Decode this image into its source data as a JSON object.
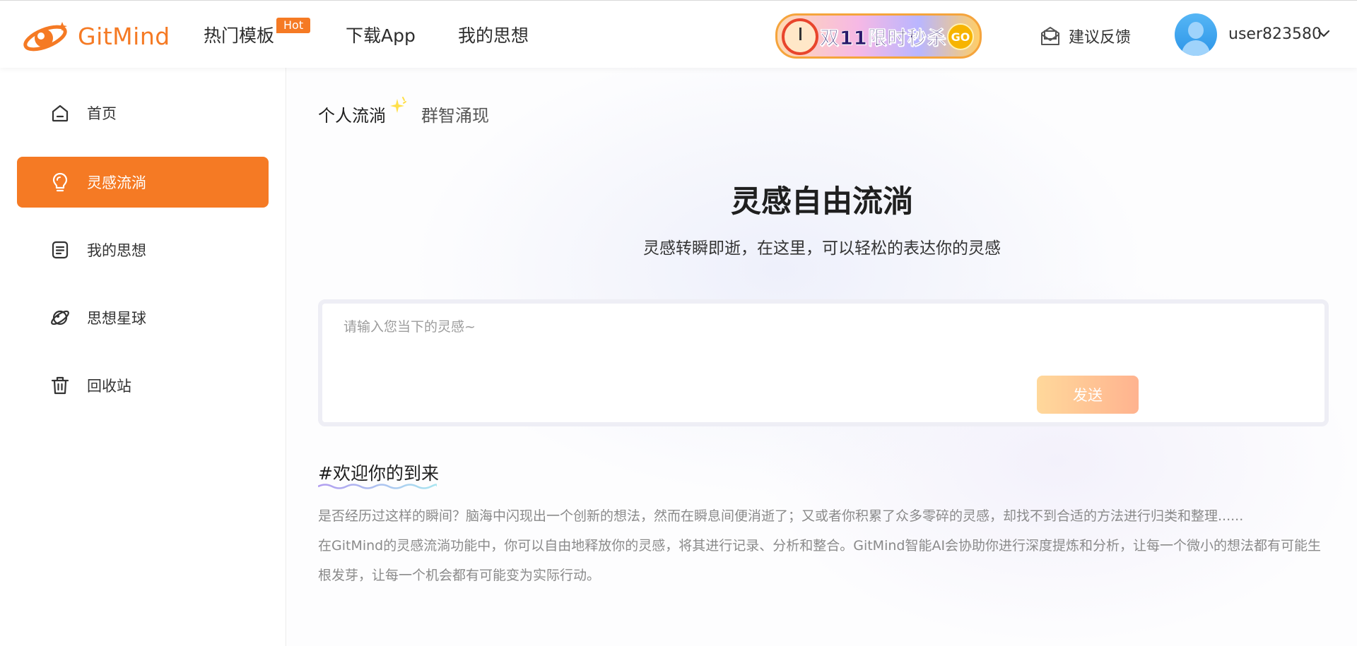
{
  "header": {
    "brand": "GitMind",
    "nav": {
      "hot_templates": "热门模板",
      "hot_badge": "Hot",
      "download_app": "下载App",
      "my_thoughts": "我的思想"
    },
    "promo": {
      "text": "双11限时秒杀!",
      "go": "GO"
    },
    "feedback": "建议反馈",
    "username": "user823580"
  },
  "sidebar": {
    "items": [
      {
        "label": "首页",
        "icon": "home-icon",
        "active": false
      },
      {
        "label": "灵感流淌",
        "icon": "lightbulb-icon",
        "active": true
      },
      {
        "label": "我的思想",
        "icon": "note-icon",
        "active": false
      },
      {
        "label": "思想星球",
        "icon": "planet-icon",
        "active": false
      },
      {
        "label": "回收站",
        "icon": "trash-icon",
        "active": false
      }
    ]
  },
  "main": {
    "tabs": [
      {
        "label": "个人流淌",
        "active": true
      },
      {
        "label": "群智涌现",
        "active": false
      }
    ],
    "title": "灵感自由流淌",
    "subtitle": "灵感转瞬即逝，在这里，可以轻松的表达你的灵感",
    "input": {
      "placeholder": "请输入您当下的灵感~",
      "value": ""
    },
    "send_label": "发送",
    "welcome": {
      "title": "#欢迎你的到来",
      "paragraphs": [
        "是否经历过这样的瞬间？脑海中闪现出一个创新的想法，然而在瞬息间便消逝了；又或者你积累了众多零碎的灵感，却找不到合适的方法进行归类和整理......",
        "在GitMind的灵感流淌功能中，你可以自由地释放你的灵感，将其进行记录、分析和整合。GitMind智能AI会协助你进行深度提炼和分析，让每一个微小的想法都有可能生根发芽，让每一个机会都有可能变为实际行动。"
      ]
    }
  },
  "colors": {
    "accent": "#f57a24",
    "send_gradient_start": "#ffd89b",
    "send_gradient_end": "#ffb38f"
  }
}
